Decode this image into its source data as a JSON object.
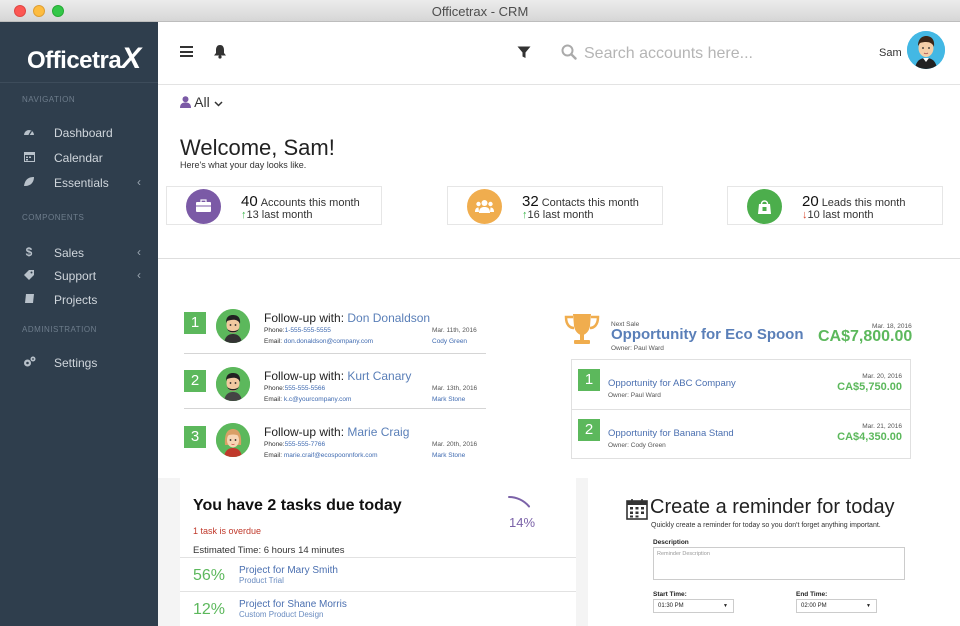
{
  "window": {
    "title": "Officetrax - CRM"
  },
  "brand": {
    "name": "Officetra",
    "x": "X"
  },
  "sidebar": {
    "sections": [
      {
        "heading": "NAVIGATION",
        "items": [
          {
            "label": "Dashboard",
            "icon": "dashboard-icon"
          },
          {
            "label": "Calendar",
            "icon": "calendar-icon"
          },
          {
            "label": "Essentials",
            "icon": "leaf-icon",
            "chevron": "‹"
          }
        ]
      },
      {
        "heading": "COMPONENTS",
        "items": [
          {
            "label": "Sales",
            "icon": "dollar-icon",
            "chevron": "‹"
          },
          {
            "label": "Support",
            "icon": "tag-icon",
            "chevron": "‹"
          },
          {
            "label": "Projects",
            "icon": "book-icon"
          }
        ]
      },
      {
        "heading": "ADMINISTRATION",
        "items": [
          {
            "label": "Settings",
            "icon": "gears-icon"
          }
        ]
      }
    ]
  },
  "topbar": {
    "search_placeholder": "Search accounts here...",
    "user_name": "Sam"
  },
  "filter": {
    "label": "All"
  },
  "welcome": {
    "title": "Welcome, Sam!",
    "subtitle": "Here's what your day looks like."
  },
  "stats": [
    {
      "count": "40",
      "label": "Accounts this month",
      "last": "13 last month",
      "trend": "up",
      "color": "#7b5aa6",
      "icon": "briefcase-icon"
    },
    {
      "count": "32",
      "label": "Contacts this month",
      "last": "16 last month",
      "trend": "up",
      "color": "#f0ad4e",
      "icon": "users-icon"
    },
    {
      "count": "20",
      "label": "Leads this month",
      "last": "10 last month",
      "trend": "down",
      "color": "#4cae4c",
      "icon": "bag-icon"
    }
  ],
  "followups": {
    "prefix": "Follow-up with: ",
    "phone_label": "Phone:",
    "email_label": "Email: ",
    "items": [
      {
        "num": "1",
        "name": "Don Donaldson",
        "phone": "1-555-555-5555",
        "email": "don.donaldson@company.com",
        "date": "Mar. 11th, 2016",
        "owner": "Cody Green"
      },
      {
        "num": "2",
        "name": "Kurt Canary",
        "phone": "555-555-5566",
        "email": "k.c@yourcompany.com",
        "date": "Mar. 13th, 2016",
        "owner": "Mark Stone"
      },
      {
        "num": "3",
        "name": "Marie Craig",
        "phone": "555-555-7766",
        "email": "marie.craif@ecospoonnfork.com",
        "date": "Mar. 20th, 2016",
        "owner": "Mark Stone"
      }
    ]
  },
  "next_sale": {
    "label": "Next Sale",
    "title": "Opportunity for Eco Spoon",
    "owner": "Owner: Paul Ward",
    "date": "Mar. 18, 2016",
    "amount": "CA$7,800.00"
  },
  "opportunities": [
    {
      "num": "1",
      "title": "Opportunity for ABC Company",
      "owner": "Owner: Paul Ward",
      "date": "Mar. 20, 2016",
      "amount": "CA$5,750.00"
    },
    {
      "num": "2",
      "title": "Opportunity for Banana Stand",
      "owner": "Owner: Cody Green",
      "date": "Mar. 21, 2016",
      "amount": "CA$4,350.00"
    }
  ],
  "tasks": {
    "title": "You have 2 tasks due today",
    "overdue": "1 task is overdue",
    "estimated": "Estimated Time: 6 hours 14 minutes",
    "progress_label": "14%",
    "progress_fraction": 0.14,
    "items": [
      {
        "pct": "56%",
        "title": "Project for Mary Smith",
        "sub": "Product Trial"
      },
      {
        "pct": "12%",
        "title": "Project for Shane Morris",
        "sub": "Custom Product Design"
      }
    ]
  },
  "reminder": {
    "title": "Create a reminder for today",
    "subtitle": "Quickly create a reminder for today so you don't forget anything important.",
    "description_label": "Description",
    "description_placeholder": "Reminder Description",
    "start_label": "Start Time:",
    "start_value": "01:30 PM",
    "end_label": "End Time:",
    "end_value": "02:00 PM"
  }
}
